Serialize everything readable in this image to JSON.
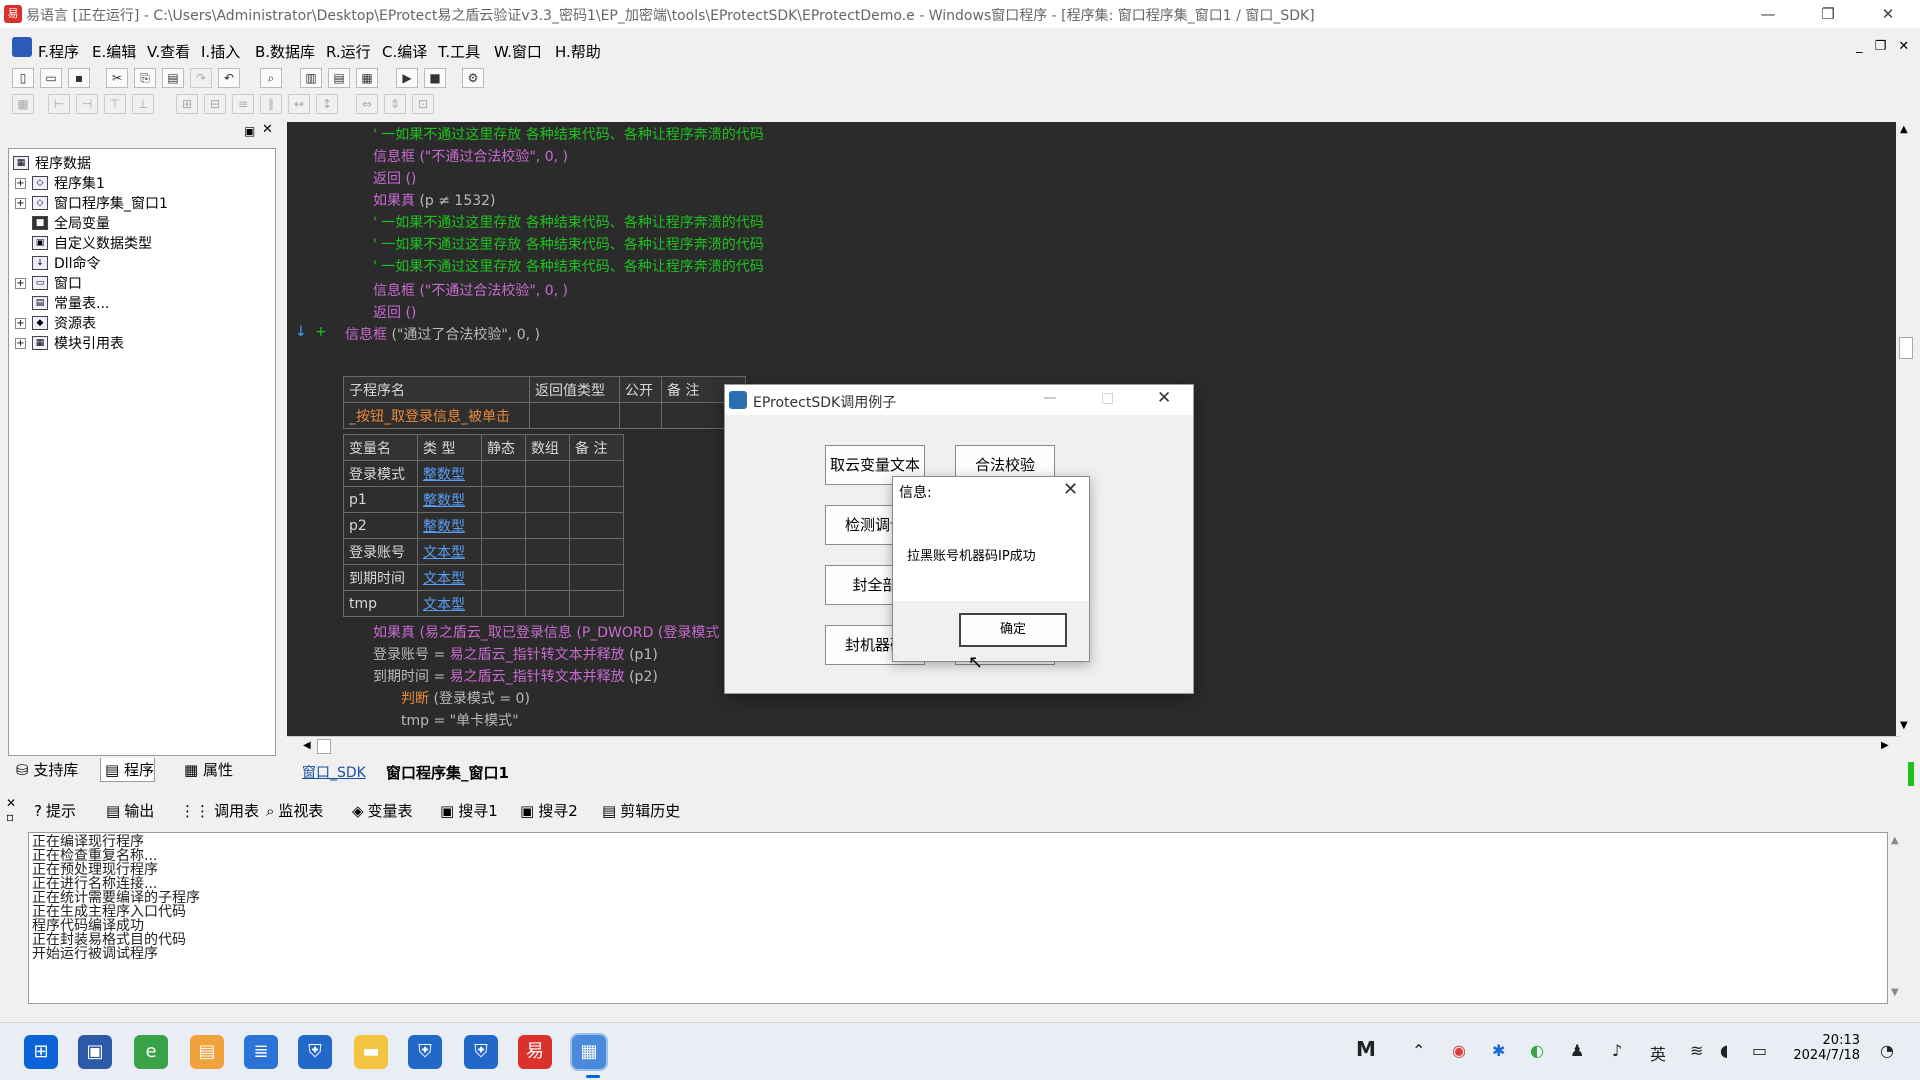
{
  "window": {
    "title": "易语言 [正在运行] - C:\\Users\\Administrator\\Desktop\\EProtect易之盾云验证v3.3_密码1\\EP_加密端\\tools\\EProtectSDK\\EProtectDemo.e - Windows窗口程序 - [程序集: 窗口程序集_窗口1 / 窗口_SDK]",
    "minimize": "—",
    "restore": "❐",
    "close": "✕"
  },
  "menubar": {
    "items": [
      "F.程序",
      "E.编辑",
      "V.查看",
      "I.插入",
      "B.数据库",
      "R.运行",
      "C.编译",
      "T.工具",
      "W.窗口",
      "H.帮助"
    ]
  },
  "tree": {
    "root": "程序数据",
    "items": [
      "程序集1",
      "窗口程序集_窗口1",
      "全局变量",
      "自定义数据类型",
      "Dll命令",
      "窗口",
      "常量表...",
      "资源表",
      "模块引用表"
    ]
  },
  "left_tabs": [
    "支持库",
    "程序",
    "属性"
  ],
  "code": {
    "line1": "' 一如果不通过这里存放 各种结束代码、各种让程序奔溃的代码",
    "line2": "信息框 (\"不通过合法校验\", 0, )",
    "line3": "返回 ()",
    "line4_kw": "如果真",
    "line4_cond": "(p ≠ 1532)",
    "line5": "' 一如果不通过这里存放 各种结束代码、各种让程序奔溃的代码",
    "line6": "' 一如果不通过这里存放 各种结束代码、各种让程序奔溃的代码",
    "line7": "' 一如果不通过这里存放 各种结束代码、各种让程序奔溃的代码",
    "line8": "信息框 (\"不通过合法校验\", 0, )",
    "line9": "返回 ()",
    "line10_kw": "信息框",
    "line10_rest": "(\"通过了合法校验\", 0, )",
    "sub_headers": [
      "子程序名",
      "返回值类型",
      "公开",
      "备 注"
    ],
    "sub_name": "_按钮_取登录信息_被单击",
    "var_headers": [
      "变量名",
      "类 型",
      "静态",
      "数组",
      "备 注"
    ],
    "vars": [
      {
        "name": "登录模式",
        "type": "整数型"
      },
      {
        "name": "p1",
        "type": "整数型"
      },
      {
        "name": "p2",
        "type": "整数型"
      },
      {
        "name": "登录账号",
        "type": "文本型"
      },
      {
        "name": "到期时间",
        "type": "文本型"
      },
      {
        "name": "tmp",
        "type": "文本型"
      }
    ],
    "l11_kw": "如果真",
    "l11_rest": "(易之盾云_取已登录信息 (P_DWORD (登录模式",
    "l12_a": "登录账号 = ",
    "l12_b": "易之盾云_指针转文本并释放",
    "l12_c": " (p1)",
    "l13_a": "到期时间 = ",
    "l13_b": "易之盾云_指针转文本并释放",
    "l13_c": " (p2)",
    "l14_kw": "判断",
    "l14_rest": "(登录模式 = 0)",
    "l15": "tmp = \"单卡模式\""
  },
  "editor_tabs": [
    "窗口_SDK",
    "窗口程序集_窗口1"
  ],
  "bottom_tabs": [
    "提示",
    "输出",
    "调用表",
    "监视表",
    "变量表",
    "搜寻1",
    "搜寻2",
    "剪辑历史"
  ],
  "output_lines": [
    "正在编译现行程序",
    "正在检查重复名称...",
    "正在预处理现行程序",
    "正在进行名称连接...",
    "正在统计需要编译的子程序",
    "正在生成主程序入口代码",
    "程序代码编译成功",
    "正在封装易格式目的代码",
    "开始运行被调试程序"
  ],
  "sdk_dialog": {
    "title": "EProtectSDK调用例子",
    "buttons": [
      "取云变量文本",
      "合法校验",
      "检测调试",
      "封全部",
      "封机器码"
    ]
  },
  "message_box": {
    "title": "信息:",
    "text": "拉黑账号机器码IP成功",
    "ok": "确定"
  },
  "taskbar": {
    "time": "20:13",
    "date": "2024/7/18",
    "ime": "英"
  }
}
